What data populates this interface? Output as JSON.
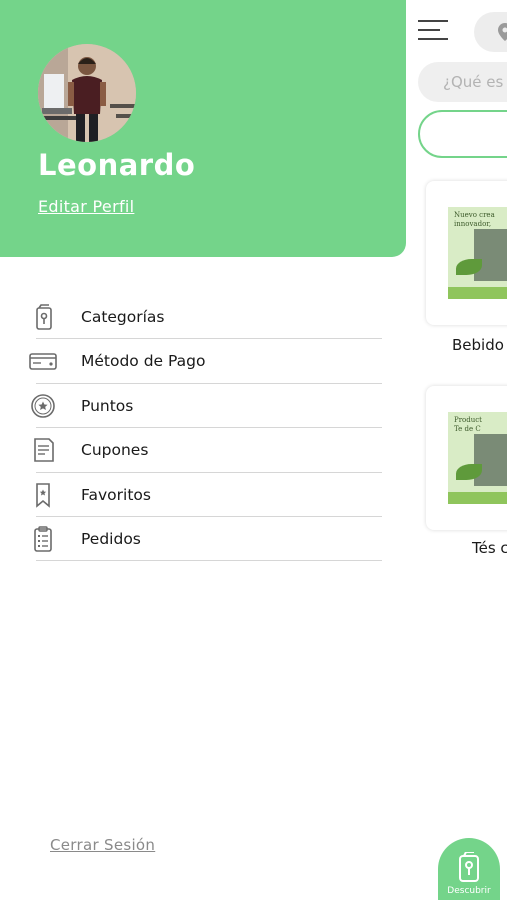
{
  "profile": {
    "name": "Leonardo",
    "edit_label": "Editar Perfil"
  },
  "menu": {
    "items": [
      {
        "label": "Categorías",
        "icon": "bottle-icon"
      },
      {
        "label": "Método de Pago",
        "icon": "credit-card-icon"
      },
      {
        "label": "Puntos",
        "icon": "star-badge-icon"
      },
      {
        "label": "Cupones",
        "icon": "coupon-document-icon"
      },
      {
        "label": "Favoritos",
        "icon": "bookmark-icon"
      },
      {
        "label": "Pedidos",
        "icon": "clipboard-list-icon"
      }
    ]
  },
  "footer": {
    "logout_label": "Cerrar Sesión"
  },
  "background_screen": {
    "search_placeholder": "¿Qué es",
    "categories": [
      {
        "label": "Bebido",
        "image_text": [
          "Nuevo crea",
          "innovador,"
        ]
      },
      {
        "label": "Tés c",
        "image_text": [
          "Product",
          "Te de C"
        ]
      }
    ],
    "discover_label": "Descubrir"
  },
  "colors": {
    "brand_green": "#74d48a",
    "text_dark": "#1a1a1a",
    "text_muted": "#8a8a8a",
    "separator": "#d6d6d6"
  }
}
